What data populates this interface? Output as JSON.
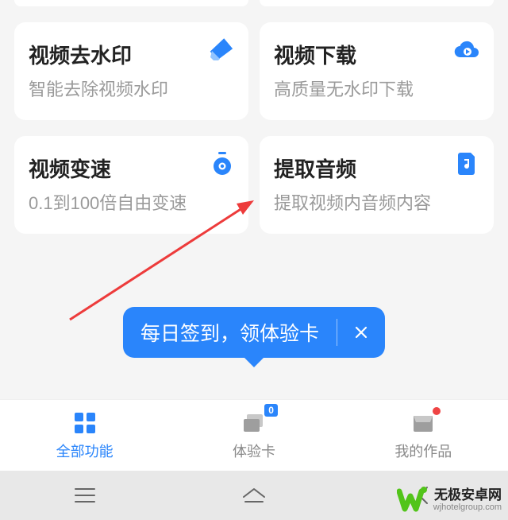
{
  "cards": {
    "r1c1": {
      "title": "视频去水印",
      "sub": "智能去除视频水印"
    },
    "r1c2": {
      "title": "视频下载",
      "sub": "高质量无水印下载"
    },
    "r2c1": {
      "title": "视频变速",
      "sub": "0.1到100倍自由变速"
    },
    "r2c2": {
      "title": "提取音频",
      "sub": "提取视频内音频内容"
    }
  },
  "tooltip": {
    "text": "每日签到，领体验卡"
  },
  "tabs": {
    "t1": {
      "label": "全部功能"
    },
    "t2": {
      "label": "体验卡",
      "badge": "0"
    },
    "t3": {
      "label": "我的作品"
    }
  },
  "watermark": {
    "line1": "无极安卓网",
    "line2": "wjhotelgroup.com"
  },
  "colors": {
    "accent": "#2a85fb"
  }
}
